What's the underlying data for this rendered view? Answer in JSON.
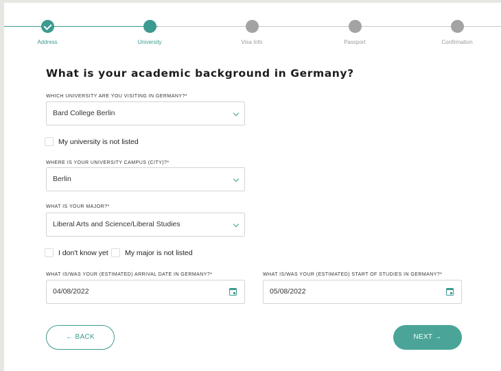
{
  "stepper": {
    "steps": [
      {
        "label": "Address",
        "state": "done"
      },
      {
        "label": "University",
        "state": "active"
      },
      {
        "label": "Visa Info",
        "state": "todo"
      },
      {
        "label": "Passport",
        "state": "todo"
      },
      {
        "label": "Confirmation",
        "state": "todo"
      }
    ]
  },
  "page": {
    "title": "What is your academic background in Germany?"
  },
  "form": {
    "university": {
      "label": "WHICH UNIVERSITY ARE YOU VISITING IN GERMANY?*",
      "value": "Bard College Berlin",
      "icon": "chevron-down-icon"
    },
    "university_not_listed": {
      "label": "My university is not listed",
      "checked": false
    },
    "campus_city": {
      "label": "WHERE IS YOUR UNIVERSITY CAMPUS (CITY)?*",
      "value": "Berlin",
      "icon": "chevron-down-icon"
    },
    "major": {
      "label": "WHAT IS YOUR MAJOR?*",
      "value": "Liberal Arts and Science/Liberal Studies",
      "icon": "chevron-down-icon"
    },
    "dont_know_yet": {
      "label": "I don't know yet",
      "checked": false
    },
    "major_not_listed": {
      "label": "My major is not listed",
      "checked": false
    },
    "arrival_date": {
      "label": "WHAT IS/WAS YOUR (ESTIMATED) ARRIVAL DATE IN GERMANY?*",
      "value": "04/08/2022",
      "icon": "calendar-icon"
    },
    "start_of_studies": {
      "label": "WHAT IS/WAS YOUR (ESTIMATED) START OF STUDIES IN GERMANY?*",
      "value": "05/08/2022",
      "icon": "calendar-icon"
    }
  },
  "buttons": {
    "back": "← BACK",
    "next": "NEXT →"
  },
  "colors": {
    "accent": "#3c9a8e",
    "inactive_step": "#a3a3a3",
    "next_button": "#4aa598"
  }
}
